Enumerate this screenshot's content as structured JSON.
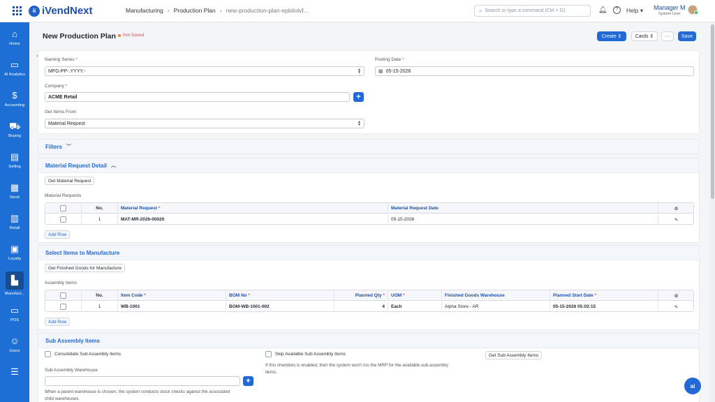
{
  "app": {
    "name": "iVendNext",
    "logo_mark": "ii"
  },
  "breadcrumbs": [
    "Manufacturing",
    "Production Plan",
    "new-production-plan-epbiiolvf..."
  ],
  "search": {
    "placeholder": "Search or type a command (Ctrl + G)"
  },
  "header": {
    "help": "Help",
    "user_name": "Manager M",
    "user_role": "System User"
  },
  "sidebar": [
    {
      "label": "Home",
      "icon": "home-icon",
      "glyph": "⌂"
    },
    {
      "label": "AI Analytics",
      "icon": "folder-icon",
      "glyph": "▭"
    },
    {
      "label": "Accounting",
      "icon": "dollar-icon",
      "glyph": "$"
    },
    {
      "label": "Buying",
      "icon": "cart-icon",
      "glyph": "⛟"
    },
    {
      "label": "Selling",
      "icon": "register-icon",
      "glyph": "▤"
    },
    {
      "label": "Stock",
      "icon": "box-icon",
      "glyph": "▦"
    },
    {
      "label": "Retail",
      "icon": "building-icon",
      "glyph": "▥"
    },
    {
      "label": "Loyalty",
      "icon": "id-card-icon",
      "glyph": "▣"
    },
    {
      "label": "Manufact...",
      "icon": "factory-icon",
      "glyph": "▙"
    },
    {
      "label": "POS",
      "icon": "monitor-icon",
      "glyph": "▭"
    },
    {
      "label": "Users",
      "icon": "users-icon",
      "glyph": "☺"
    },
    {
      "label": "",
      "icon": "sliders-icon",
      "glyph": "☰"
    }
  ],
  "page": {
    "title": "New Production Plan",
    "status": "Not Saved",
    "create": "Create",
    "cards": "Cards",
    "more": "···",
    "save": "Save"
  },
  "form": {
    "naming_series_label": "Naming Series",
    "naming_series_value": "MFG-PP-.YYYY.-",
    "posting_date_label": "Posting Date",
    "posting_date_value": "05-15-2026",
    "company_label": "Company",
    "company_value": "ACME Retail",
    "get_items_label": "Get Items From",
    "get_items_value": "Material Request",
    "required": "*"
  },
  "filters": {
    "title": "Filters"
  },
  "mr_section": {
    "title": "Material Request Detail",
    "get_button": "Get Material Request",
    "table_label": "Material Requests",
    "headers": [
      "No.",
      "Material Request",
      "Material Request Date"
    ],
    "rows": [
      {
        "no": "1",
        "request": "MAT-MR-2026-00020",
        "date": "05-15-2026"
      }
    ],
    "add_row": "Add Row"
  },
  "items_section": {
    "title": "Select Items to Manufacture",
    "get_button": "Get Finished Goods for Manufacture",
    "table_label": "Assembly Items",
    "headers": [
      "No.",
      "Item Code",
      "BOM No",
      "Planned Qty",
      "UOM",
      "Finished Goods Warehouse",
      "Planned Start Date"
    ],
    "rows": [
      {
        "no": "1",
        "item_code": "WB-1001",
        "bom": "BOM-WB-1001-002",
        "qty": "4",
        "uom": "Each",
        "warehouse": "Alpha Store - AR",
        "start": "05-15-2026 05:02:15"
      }
    ],
    "add_row": "Add Row"
  },
  "sub_section": {
    "title": "Sub Assembly Items",
    "consolidate": "Consolidate Sub Assembly Items",
    "skip": "Skip Available Sub Assembly Items",
    "skip_help_1": "If this checkbox is enabled, then the system won't run the MRP for the available sub-assembly",
    "skip_help_2": "items.",
    "get_button": "Get Sub Assembly Items",
    "warehouse_label": "Sub Assembly Warehouse",
    "warehouse_help_1": "When a parent warehouse is chosen, the system conducts stock checks against the associated",
    "warehouse_help_2": "child warehouses"
  },
  "ai_button": "ai"
}
